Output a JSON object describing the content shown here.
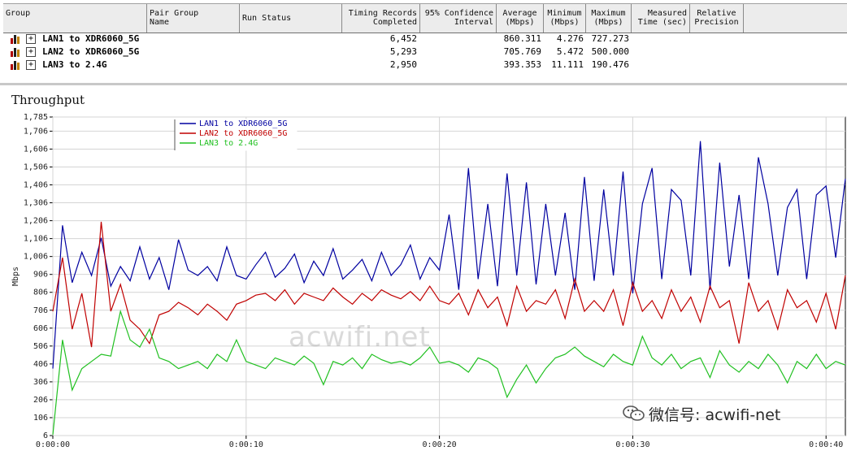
{
  "table": {
    "headers": [
      {
        "key": "group",
        "label": "Group"
      },
      {
        "key": "pair_group_name",
        "label": "Pair Group\nName"
      },
      {
        "key": "run_status",
        "label": "Run Status"
      },
      {
        "key": "timing_records",
        "label": "Timing Records\nCompleted"
      },
      {
        "key": "confidence",
        "label": "95% Confidence\nInterval"
      },
      {
        "key": "average",
        "label": "Average\n(Mbps)"
      },
      {
        "key": "minimum",
        "label": "Minimum\n(Mbps)"
      },
      {
        "key": "maximum",
        "label": "Maximum\n(Mbps)"
      },
      {
        "key": "measured_time",
        "label": "Measured\nTime (sec)"
      },
      {
        "key": "relative_precision",
        "label": "Relative\nPrecision"
      }
    ],
    "rows": [
      {
        "group": "LAN1 to XDR6060_5G",
        "expander": "+",
        "timing_records": "6,452",
        "average": "860.311",
        "minimum": "4.276",
        "maximum": "727.273"
      },
      {
        "group": "LAN2 to XDR6060_5G",
        "expander": "+",
        "timing_records": "5,293",
        "average": "705.769",
        "minimum": "5.472",
        "maximum": "500.000"
      },
      {
        "group": "LAN3 to 2.4G",
        "expander": "+",
        "timing_records": "2,950",
        "average": "393.353",
        "minimum": "11.111",
        "maximum": "190.476"
      }
    ]
  },
  "watermark": "acwifi.net",
  "wechat_text": "微信号: acwifi-net",
  "wechat_icon": "wechat-icon",
  "chart_data": {
    "type": "line",
    "title": "Throughput",
    "xlabel": "",
    "ylabel": "Mbps",
    "yticks": [
      6,
      106,
      206,
      306,
      406,
      506,
      606,
      706,
      806,
      906,
      1006,
      1106,
      1206,
      1306,
      1406,
      1506,
      1606,
      1706,
      1785
    ],
    "ytick_labels": [
      "6",
      "106",
      "206",
      "306",
      "406",
      "506",
      "606",
      "706",
      "806",
      "906",
      "1,006",
      "1,106",
      "1,206",
      "1,306",
      "1,406",
      "1,506",
      "1,606",
      "1,706",
      "1,785"
    ],
    "ylim": [
      6,
      1785
    ],
    "xlim": [
      0,
      41
    ],
    "xticks": [
      0,
      10,
      20,
      30,
      40
    ],
    "xtick_labels": [
      "0:00:00",
      "0:00:10",
      "0:00:20",
      "0:00:30",
      "0:00:40"
    ],
    "grid": true,
    "legend_position": "top-left",
    "series": [
      {
        "name": "LAN1 to XDR6060_5G",
        "color": "#0000a0",
        "x": [
          0,
          0.5,
          1,
          1.5,
          2,
          2.5,
          3,
          3.5,
          4,
          4.5,
          5,
          5.5,
          6,
          6.5,
          7,
          7.5,
          8,
          8.5,
          9,
          9.5,
          10,
          10.5,
          11,
          11.5,
          12,
          12.5,
          13,
          13.5,
          14,
          14.5,
          15,
          15.5,
          16,
          16.5,
          17,
          17.5,
          18,
          18.5,
          19,
          19.5,
          20,
          20.5,
          21,
          21.5,
          22,
          22.5,
          23,
          23.5,
          24,
          24.5,
          25,
          25.5,
          26,
          26.5,
          27,
          27.5,
          28,
          28.5,
          29,
          29.5,
          30,
          30.5,
          31,
          31.5,
          32,
          32.5,
          33,
          33.5,
          34,
          34.5,
          35,
          35.5,
          36,
          36.5,
          37,
          37.5,
          38,
          38.5,
          39,
          39.5,
          40,
          40.5,
          41
        ],
        "y": [
          380,
          1180,
          860,
          1030,
          900,
          1110,
          840,
          950,
          870,
          1060,
          880,
          1000,
          820,
          1100,
          930,
          900,
          950,
          870,
          1060,
          900,
          880,
          960,
          1030,
          890,
          940,
          1020,
          860,
          980,
          900,
          1050,
          880,
          930,
          990,
          870,
          1030,
          900,
          960,
          1070,
          880,
          1000,
          930,
          1240,
          820,
          1500,
          880,
          1300,
          840,
          1470,
          900,
          1420,
          850,
          1300,
          900,
          1250,
          820,
          1450,
          870,
          1380,
          900,
          1480,
          800,
          1300,
          1500,
          880,
          1380,
          1320,
          900,
          1650,
          820,
          1530,
          950,
          1350,
          880,
          1560,
          1300,
          900,
          1280,
          1380,
          880,
          1350,
          1400,
          1000,
          1440
        ]
      },
      {
        "name": "LAN2 to XDR6060_5G",
        "color": "#c00000",
        "x": [
          0,
          0.5,
          1,
          1.5,
          2,
          2.5,
          3,
          3.5,
          4,
          4.5,
          5,
          5.5,
          6,
          6.5,
          7,
          7.5,
          8,
          8.5,
          9,
          9.5,
          10,
          10.5,
          11,
          11.5,
          12,
          12.5,
          13,
          13.5,
          14,
          14.5,
          15,
          15.5,
          16,
          16.5,
          17,
          17.5,
          18,
          18.5,
          19,
          19.5,
          20,
          20.5,
          21,
          21.5,
          22,
          22.5,
          23,
          23.5,
          24,
          24.5,
          25,
          25.5,
          26,
          26.5,
          27,
          27.5,
          28,
          28.5,
          29,
          29.5,
          30,
          30.5,
          31,
          31.5,
          32,
          32.5,
          33,
          33.5,
          34,
          34.5,
          35,
          35.5,
          36,
          36.5,
          37,
          37.5,
          38,
          38.5,
          39,
          39.5,
          40,
          40.5,
          41
        ],
        "y": [
          700,
          1000,
          600,
          800,
          500,
          1200,
          700,
          850,
          650,
          600,
          520,
          680,
          700,
          750,
          720,
          680,
          740,
          700,
          650,
          740,
          760,
          790,
          800,
          760,
          820,
          740,
          800,
          780,
          760,
          830,
          780,
          740,
          800,
          760,
          820,
          790,
          770,
          810,
          760,
          840,
          760,
          740,
          800,
          680,
          820,
          720,
          780,
          620,
          840,
          700,
          760,
          740,
          820,
          660,
          880,
          700,
          760,
          700,
          820,
          620,
          860,
          700,
          760,
          660,
          820,
          700,
          780,
          640,
          840,
          720,
          760,
          520,
          860,
          700,
          760,
          600,
          820,
          720,
          760,
          640,
          800,
          600,
          900
        ]
      },
      {
        "name": "LAN3 to 2.4G",
        "color": "#20c020",
        "x": [
          0,
          0.5,
          1,
          1.5,
          2,
          2.5,
          3,
          3.5,
          4,
          4.5,
          5,
          5.5,
          6,
          6.5,
          7,
          7.5,
          8,
          8.5,
          9,
          9.5,
          10,
          10.5,
          11,
          11.5,
          12,
          12.5,
          13,
          13.5,
          14,
          14.5,
          15,
          15.5,
          16,
          16.5,
          17,
          17.5,
          18,
          18.5,
          19,
          19.5,
          20,
          20.5,
          21,
          21.5,
          22,
          22.5,
          23,
          23.5,
          24,
          24.5,
          25,
          25.5,
          26,
          26.5,
          27,
          27.5,
          28,
          28.5,
          29,
          29.5,
          30,
          30.5,
          31,
          31.5,
          32,
          32.5,
          33,
          33.5,
          34,
          34.5,
          35,
          35.5,
          36,
          36.5,
          37,
          37.5,
          38,
          38.5,
          39,
          39.5,
          40,
          40.5,
          41
        ],
        "y": [
          10,
          540,
          260,
          380,
          420,
          460,
          450,
          700,
          540,
          500,
          600,
          440,
          420,
          380,
          400,
          420,
          380,
          460,
          420,
          540,
          420,
          400,
          380,
          440,
          420,
          400,
          450,
          410,
          290,
          420,
          400,
          440,
          380,
          460,
          430,
          410,
          420,
          400,
          440,
          500,
          410,
          420,
          400,
          360,
          440,
          420,
          380,
          220,
          320,
          400,
          300,
          380,
          440,
          460,
          500,
          450,
          420,
          390,
          460,
          420,
          400,
          560,
          440,
          400,
          460,
          380,
          420,
          440,
          330,
          480,
          400,
          360,
          420,
          380,
          460,
          400,
          300,
          420,
          380,
          460,
          380,
          420,
          400
        ]
      }
    ]
  }
}
